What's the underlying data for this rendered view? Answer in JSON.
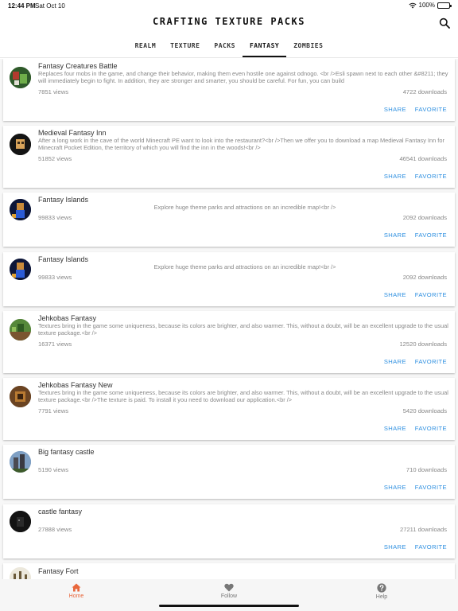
{
  "status_bar": {
    "time": "12:44 PM",
    "date": "Sat Oct 10",
    "battery": "100%"
  },
  "app": {
    "title": "CRAFTING TEXTURE PACKS"
  },
  "tabs": [
    "REALM",
    "TEXTURE",
    "PACKS",
    "FANTASY",
    "ZOMBIES"
  ],
  "active_tab": "FANTASY",
  "items": [
    {
      "title": "Fantasy Creatures Battle",
      "desc": "Replaces four mobs in the game, and change their behavior, making them even hostile one against odnogo. <br />Esli spawn next to each other &#8211; they will immediately begin to fight. In addition, they are stronger and smarter, you should be careful. For fun, you can build",
      "views": "7851 views",
      "downloads": "4722 downloads",
      "share": "SHARE",
      "favorite": "FAVORITE"
    },
    {
      "title": "Medieval Fantasy Inn",
      "desc": "After a long work in the cave of the world Minecraft PE want to look into the restaurant?<br />Then we offer you to download a map Medieval Fantasy Inn for Minecraft Pocket Edition, the territory of which you will find the inn in the woods!<br />",
      "views": "51852 views",
      "downloads": "46541 downloads",
      "share": "SHARE",
      "favorite": "FAVORITE"
    },
    {
      "title": "Fantasy Islands",
      "desc": "Explore huge theme parks and attractions on an incredible map!<br />",
      "views": "99833 views",
      "downloads": "2092 downloads",
      "share": "SHARE",
      "favorite": "FAVORITE"
    },
    {
      "title": "Fantasy Islands",
      "desc": "Explore huge theme parks and attractions on an incredible map!<br />",
      "views": "99833 views",
      "downloads": "2092 downloads",
      "share": "SHARE",
      "favorite": "FAVORITE"
    },
    {
      "title": "Jehkobas Fantasy",
      "desc": "Textures bring in the game some uniqueness, because its colors are brighter, and also warmer. This, without a doubt, will be an excellent upgrade to the usual texture package.<br />",
      "views": "16371 views",
      "downloads": "12520 downloads",
      "share": "SHARE",
      "favorite": "FAVORITE"
    },
    {
      "title": "Jehkobas Fantasy New",
      "desc": "Textures bring in the game some uniqueness, because its colors are brighter, and also warmer. This, without a doubt, will be an excellent upgrade to the usual texture package.<br />The texture is paid. To install it you need to download our application.<br />",
      "views": "7791 views",
      "downloads": "5420 downloads",
      "share": "SHARE",
      "favorite": "FAVORITE"
    },
    {
      "title": "Big fantasy castle",
      "desc": "",
      "views": "5190 views",
      "downloads": "710 downloads",
      "share": "SHARE",
      "favorite": "FAVORITE"
    },
    {
      "title": "castle fantasy",
      "desc": "",
      "views": "27888 views",
      "downloads": "27211 downloads",
      "share": "SHARE",
      "favorite": "FAVORITE"
    },
    {
      "title": "Fantasy Fort",
      "desc": "",
      "views": "",
      "downloads": "",
      "share": "",
      "favorite": ""
    }
  ],
  "bottom_nav": [
    {
      "label": "Home",
      "icon": "home-icon"
    },
    {
      "label": "Follow",
      "icon": "heart-icon"
    },
    {
      "label": "Help",
      "icon": "help-icon"
    }
  ],
  "colors": {
    "accent": "#2d8fe0",
    "active_nav": "#e8673c"
  }
}
